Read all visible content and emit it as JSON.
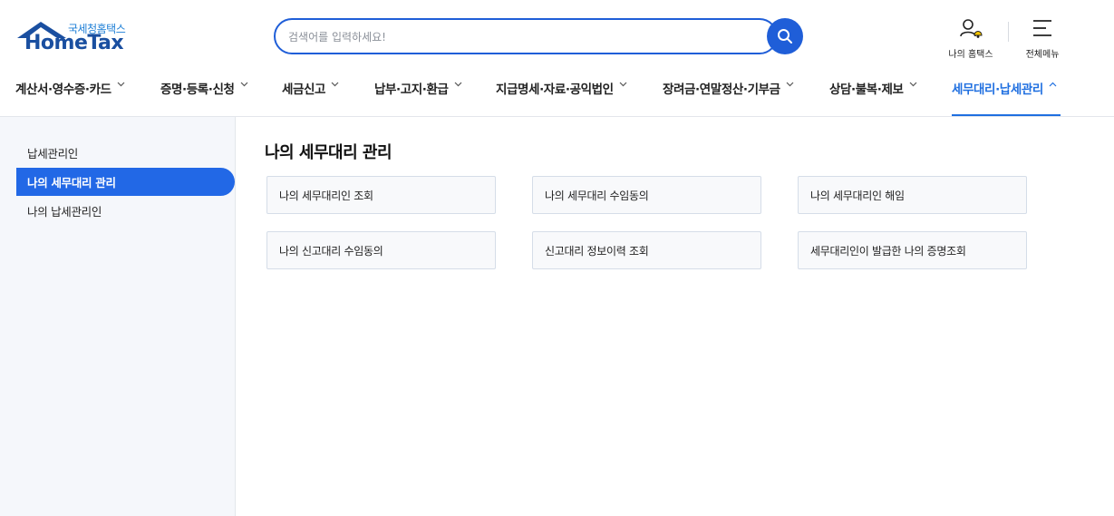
{
  "logo": {
    "sub": "국세청홈택스",
    "main": "HomeTax"
  },
  "search": {
    "placeholder": "검색어를 입력하세요!"
  },
  "utility": {
    "my_hometax": "나의 홈택스",
    "all_menu": "전체메뉴"
  },
  "gnb": [
    {
      "label": "계산서·영수증·카드",
      "active": false
    },
    {
      "label": "증명·등록·신청",
      "active": false
    },
    {
      "label": "세금신고",
      "active": false
    },
    {
      "label": "납부·고지·환급",
      "active": false
    },
    {
      "label": "지급명세·자료·공익법인",
      "active": false
    },
    {
      "label": "장려금·연말정산·기부금",
      "active": false
    },
    {
      "label": "상담·불복·제보",
      "active": false
    },
    {
      "label": "세무대리·납세관리",
      "active": true
    }
  ],
  "side": {
    "items": [
      {
        "label": "납세관리인",
        "active": false
      },
      {
        "label": "나의 세무대리 관리",
        "active": true
      },
      {
        "label": "나의 납세관리인",
        "active": false
      }
    ]
  },
  "main": {
    "title": "나의 세무대리 관리",
    "cards": [
      "나의 세무대리인 조회",
      "나의 세무대리 수임동의",
      "나의 세무대리인 해임",
      "나의 신고대리 수임동의",
      "신고대리 정보이력 조회",
      "세무대리인이 발급한 나의 증명조회"
    ]
  },
  "colors": {
    "brand": "#1f5ed8",
    "active_nav": "#1f6fe0",
    "side_active": "#2268e6"
  }
}
